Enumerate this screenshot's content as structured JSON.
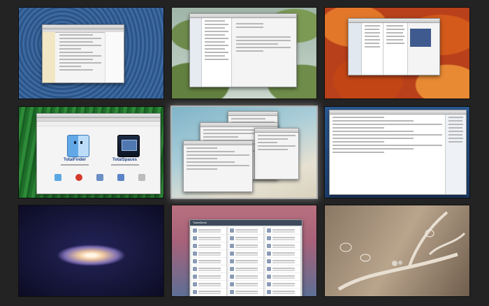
{
  "screen": {
    "type": "space-overview",
    "background": "#232323",
    "selected_index": 4,
    "spaces": [
      {
        "name": "desktop-1",
        "wallpaper": "zen-sand-blue",
        "app": "web-browser"
      },
      {
        "name": "desktop-2",
        "wallpaper": "lily-pads",
        "app": "mail"
      },
      {
        "name": "desktop-3",
        "wallpaper": "autumn-leaves",
        "app": "file-browser"
      },
      {
        "name": "desktop-4",
        "wallpaper": "green-grass",
        "app": "totalfinder-website"
      },
      {
        "name": "desktop-5",
        "wallpaper": "beach",
        "app": "text-windows"
      },
      {
        "name": "desktop-6",
        "wallpaper": "blue",
        "app": "text-editor"
      },
      {
        "name": "desktop-7",
        "wallpaper": "galaxy",
        "app": "none"
      },
      {
        "name": "desktop-8",
        "wallpaper": "pink-sky",
        "app": "tweetdeck"
      },
      {
        "name": "desktop-9",
        "wallpaper": "branch-bugs",
        "app": "none"
      }
    ]
  },
  "totalfinder_site": {
    "product1": "TotalFinder",
    "product2": "TotalSpaces"
  },
  "tweetdeck": {
    "title": "TweetDeck"
  },
  "colors": {
    "selection_glow": "#ffffff",
    "window_bg": "#f4f4f4",
    "link_blue": "#1d3f8a"
  }
}
